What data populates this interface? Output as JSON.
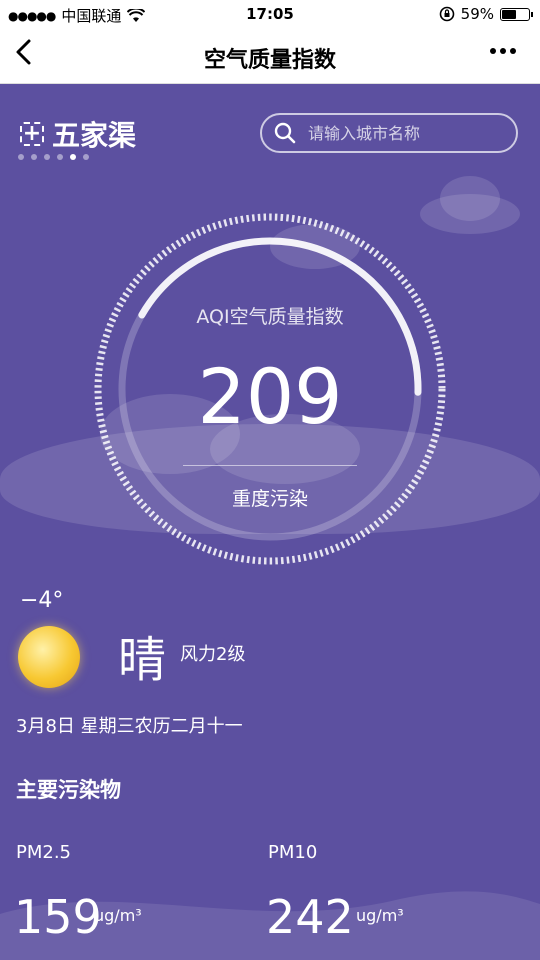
{
  "status_bar": {
    "carrier": "中国联通",
    "time": "17:05",
    "battery": "59%",
    "battery_level": 0.59
  },
  "nav": {
    "back_icon": "chevron-left-icon",
    "title": "空气质量指数",
    "more_icon": "more-dots-icon"
  },
  "city": {
    "add_icon": "plus-icon",
    "name": "五家渠",
    "pages": 6,
    "active_page": 5
  },
  "search": {
    "icon": "search-icon",
    "placeholder": "请输入城市名称"
  },
  "aqi": {
    "label": "AQI空气质量指数",
    "value": "209",
    "level": "重度污染",
    "progress": 0.42
  },
  "weather": {
    "temperature": "−4°",
    "condition_icon": "sun-icon",
    "condition": "晴",
    "wind": "风力2级",
    "date": "3月8日  星期三农历二月十一"
  },
  "pollutants": {
    "title": "主要污染物",
    "items": [
      {
        "name": "PM2.5",
        "value": "159",
        "unit": "ug/m³"
      },
      {
        "name": "PM10",
        "value": "242",
        "unit": "ug/m³"
      }
    ]
  },
  "colors": {
    "background": "#5c50a0",
    "accent": "#ffffff"
  }
}
